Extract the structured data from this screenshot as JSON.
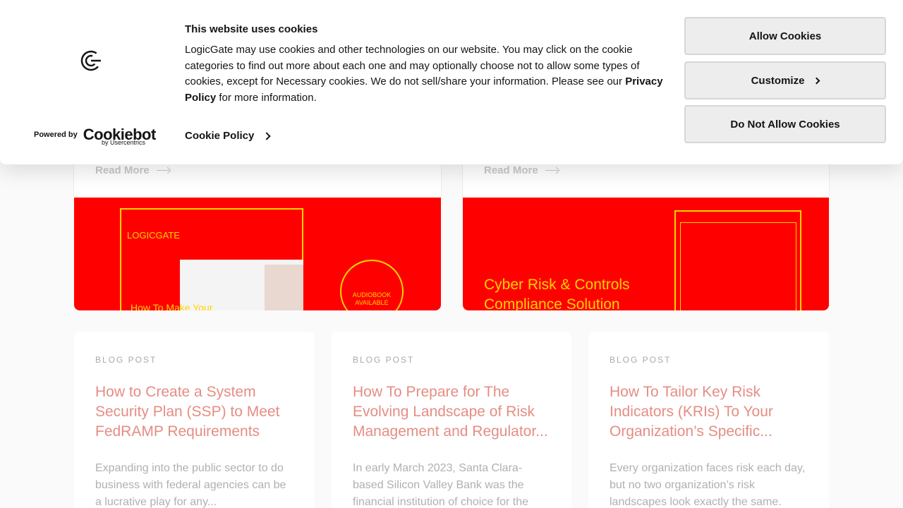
{
  "cookie_banner": {
    "title": "This website uses cookies",
    "body_text": "LogicGate may use cookies and other technologies on our website. You may click on the cookie categories to find out more about each one and may optionally choose not to allow some types of cookies, except for Necessary cookies.  We do not sell/share your information. Please see our ",
    "privacy_link": "Privacy Policy",
    "body_suffix": " for more information.",
    "cookie_policy_link": "Cookie Policy",
    "powered_by": "Powered by",
    "brand": "Cookiebot",
    "brand_sub": "by Usercentrics",
    "buttons": {
      "allow": "Allow Cookies",
      "customize": "Customize",
      "deny": "Do Not Allow Cookies"
    }
  },
  "featured": [
    {
      "read_more": "Read More",
      "image_text_brand": "LOGICGATE",
      "image_text_title": "How To Make Your",
      "image_badge": "AUDIOBOOK AVAILABLE"
    },
    {
      "read_more": "Read More",
      "image_text_line1": "Cyber Risk & Controls",
      "image_text_line2": "Compliance Solution"
    }
  ],
  "posts": [
    {
      "tag": "BLOG POST",
      "title": "How to Create a System Security Plan (SSP) to Meet FedRAMP Requirements",
      "excerpt": "Expanding into the public sector to do business with federal agencies can be a lucrative play for any..."
    },
    {
      "tag": "BLOG POST",
      "title": "How To Prepare for The Evolving Landscape of Risk Management and Regulator...",
      "excerpt": "In early March 2023, Santa Clara-based Silicon Valley Bank was the financial institution of choice for the"
    },
    {
      "tag": "BLOG POST",
      "title": "How To Tailor Key Risk Indicators (KRIs) To Your Organization’s Specific...",
      "excerpt": "Every organization faces risk each day, but no two organization’s risk landscapes look exactly the same."
    }
  ],
  "colors": {
    "accent_title": "#e58d83",
    "image_bg": "#ff0000",
    "image_line": "#ffd400"
  }
}
